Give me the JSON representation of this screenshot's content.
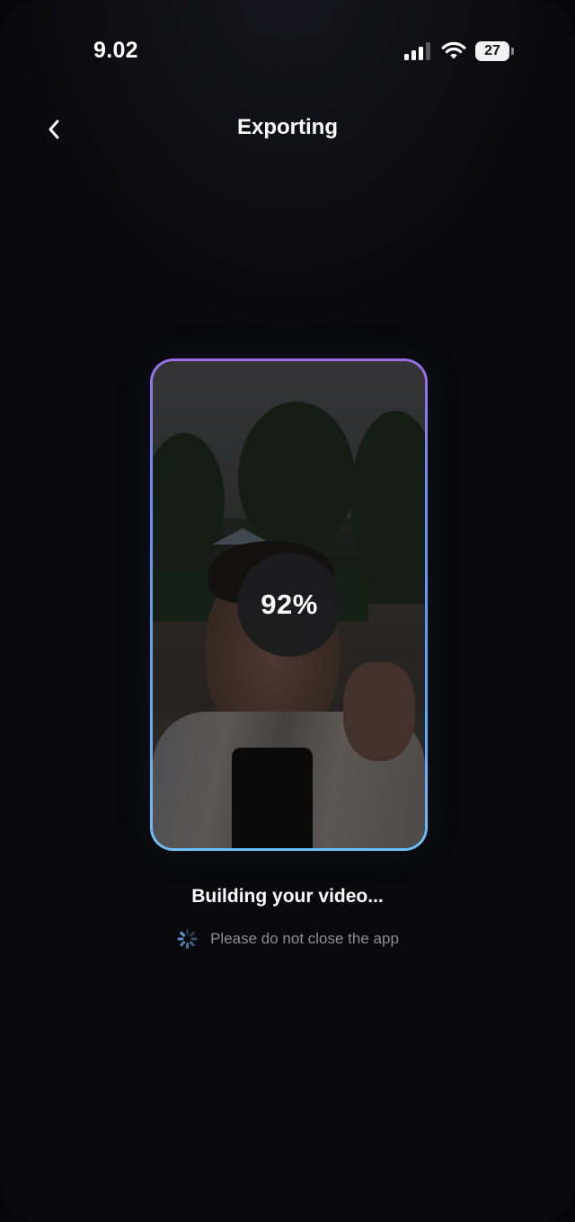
{
  "status_bar": {
    "time": "9.02",
    "battery_level": "27",
    "signal_icon": "cellular-signal-icon",
    "wifi_icon": "wifi-icon",
    "battery_icon": "battery-icon"
  },
  "nav": {
    "title": "Exporting",
    "back_icon": "chevron-left-icon"
  },
  "export": {
    "progress_label": "92%",
    "progress_value": 92,
    "status_text": "Building your video...",
    "warning_text": "Please do not close the app",
    "spinner_icon": "loading-spinner-icon"
  },
  "colors": {
    "background": "#09090b",
    "frame_gradient_top": "#9b6ee8",
    "frame_gradient_bottom": "#6cc0f6",
    "text_primary": "#ffffff",
    "text_secondary": "#8e8e93"
  }
}
